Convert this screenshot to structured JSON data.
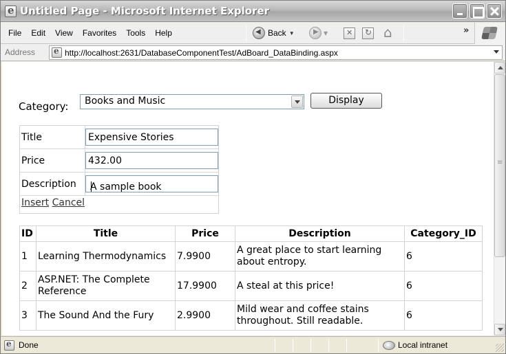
{
  "window": {
    "title": "Untitled Page - Microsoft Internet Explorer"
  },
  "menu": [
    "File",
    "Edit",
    "View",
    "Favorites",
    "Tools",
    "Help"
  ],
  "toolbar": {
    "back_label": "Back",
    "overflow": "»"
  },
  "address": {
    "label": "Address",
    "url": "http://localhost:2631/DatabaseComponentTest/AdBoard_DataBinding.aspx"
  },
  "page": {
    "category_label": "Category:",
    "category_selected": "Books and Music",
    "display_button": "Display",
    "form": {
      "title_label": "Title",
      "title_value": "Expensive Stories",
      "price_label": "Price",
      "price_value": "432.00",
      "description_label": "Description",
      "description_value": "A sample book",
      "insert_link": "Insert",
      "cancel_link": "Cancel"
    },
    "table": {
      "headers": [
        "ID",
        "Title",
        "Price",
        "Description",
        "Category_ID"
      ],
      "rows": [
        [
          "1",
          "Learning Thermodynamics",
          "7.9900",
          "A great place to start learning about entropy.",
          "6"
        ],
        [
          "2",
          "ASP.NET: The Complete Reference",
          "17.9900",
          "A steal at this price!",
          "6"
        ],
        [
          "3",
          "The Sound And the Fury",
          "2.9900",
          "Mild wear and coffee stains throughout. Still readable.",
          "6"
        ]
      ]
    }
  },
  "status": {
    "text": "Done",
    "zone": "Local intranet"
  }
}
